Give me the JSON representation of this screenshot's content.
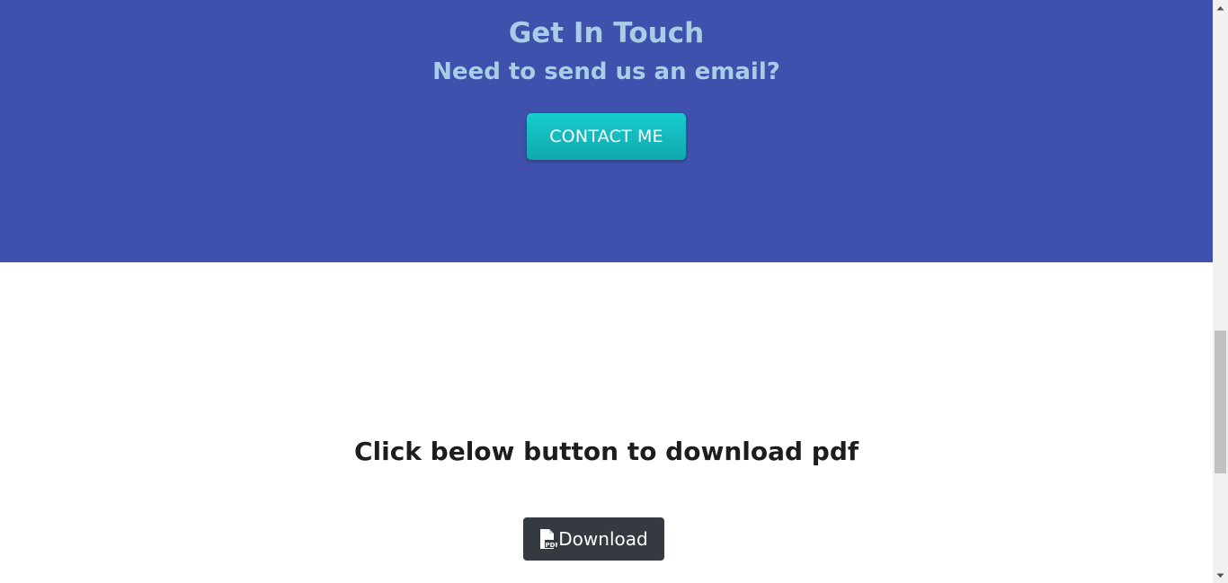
{
  "contact": {
    "title": "Get In Touch",
    "subtitle": "Need to send us an email?",
    "button_label": "CONTACT ME",
    "background_color": "#3f51ac",
    "text_color": "#a9cde6",
    "button_color": "#14b9bd"
  },
  "download": {
    "heading": "Click below button to download pdf",
    "button_label": "Download",
    "button_icon": "pdf-file-icon",
    "button_color": "#343a40"
  },
  "scrollbar": {
    "up_icon": "scroll-up-arrow-icon",
    "down_icon": "scroll-down-arrow-icon"
  }
}
